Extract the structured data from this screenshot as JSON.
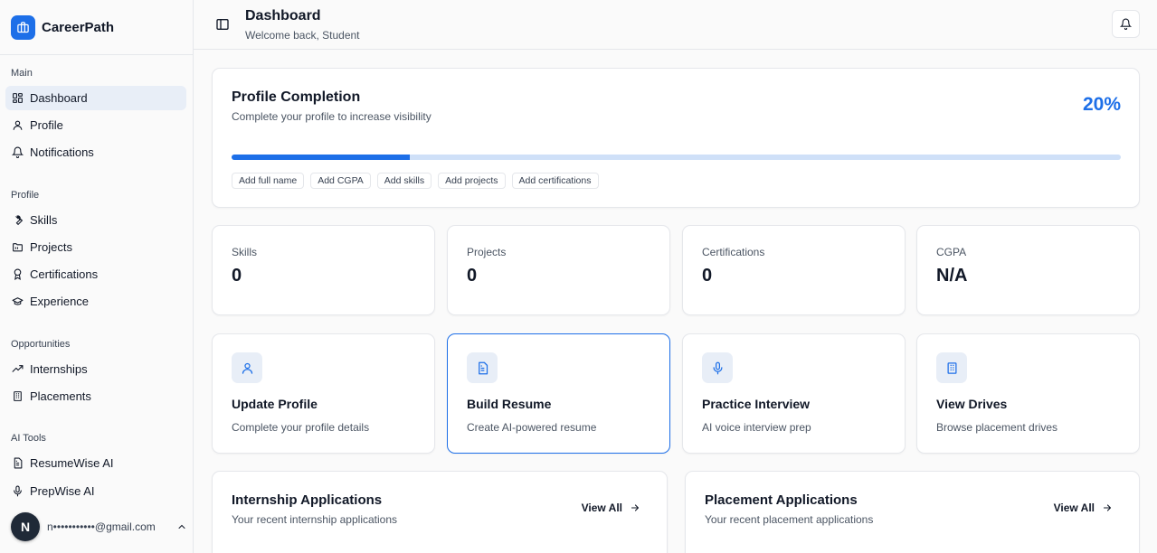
{
  "brand": {
    "name": "CareerPath"
  },
  "sidebar": {
    "sections": [
      {
        "label": "Main",
        "items": [
          {
            "label": "Dashboard",
            "icon": "grid-icon",
            "active": true
          },
          {
            "label": "Profile",
            "icon": "user-icon"
          },
          {
            "label": "Notifications",
            "icon": "bell-icon"
          }
        ]
      },
      {
        "label": "Profile",
        "items": [
          {
            "label": "Skills",
            "icon": "wrench-icon"
          },
          {
            "label": "Projects",
            "icon": "folder-icon"
          },
          {
            "label": "Certifications",
            "icon": "award-icon"
          },
          {
            "label": "Experience",
            "icon": "graduation-cap-icon"
          }
        ]
      },
      {
        "label": "Opportunities",
        "items": [
          {
            "label": "Internships",
            "icon": "trending-up-icon"
          },
          {
            "label": "Placements",
            "icon": "building-icon"
          }
        ]
      },
      {
        "label": "AI Tools",
        "items": [
          {
            "label": "ResumeWise AI",
            "icon": "file-text-icon"
          },
          {
            "label": "PrepWise AI",
            "icon": "mic-icon"
          }
        ]
      }
    ],
    "user": {
      "avatar_initial": "N",
      "email": "n•••••••••••@gmail.com"
    }
  },
  "header": {
    "title": "Dashboard",
    "subtitle": "Welcome back, Student"
  },
  "profile_completion": {
    "title": "Profile Completion",
    "subtitle": "Complete your profile to increase visibility",
    "percent_label": "20%",
    "progress": 0.2,
    "chips": [
      "Add full name",
      "Add CGPA",
      "Add skills",
      "Add projects",
      "Add certifications"
    ]
  },
  "stats": [
    {
      "label": "Skills",
      "value": "0"
    },
    {
      "label": "Projects",
      "value": "0"
    },
    {
      "label": "Certifications",
      "value": "0"
    },
    {
      "label": "CGPA",
      "value": "N/A"
    }
  ],
  "actions": [
    {
      "title": "Update Profile",
      "subtitle": "Complete your profile details",
      "icon": "user-icon"
    },
    {
      "title": "Build Resume",
      "subtitle": "Create AI-powered resume",
      "icon": "file-text-icon"
    },
    {
      "title": "Practice Interview",
      "subtitle": "AI voice interview prep",
      "icon": "mic-icon"
    },
    {
      "title": "View Drives",
      "subtitle": "Browse placement drives",
      "icon": "building-icon"
    }
  ],
  "applications": [
    {
      "title": "Internship Applications",
      "subtitle": "Your recent internship applications",
      "view_all": "View All"
    },
    {
      "title": "Placement Applications",
      "subtitle": "Your recent placement applications",
      "view_all": "View All"
    }
  ],
  "colors": {
    "accent": "#1d6fe8",
    "accent_light": "#cfe0f8",
    "active_bg": "#e8eef7"
  }
}
